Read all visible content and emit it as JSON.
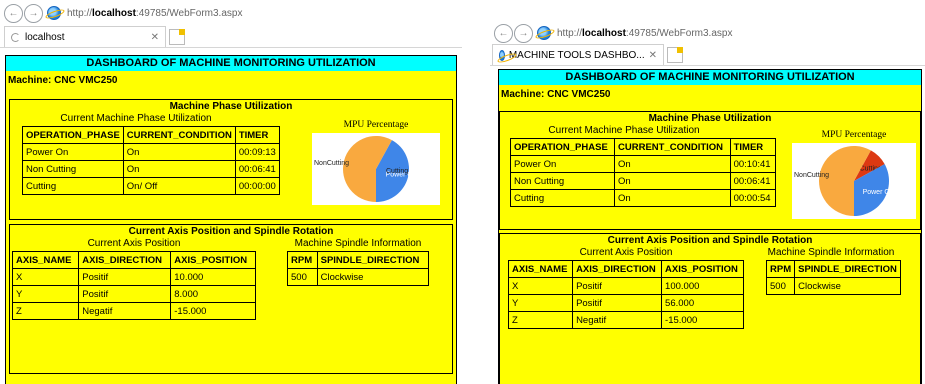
{
  "left": {
    "url_prefix": "http://",
    "url_host": "localhost",
    "url_rest": ":49785/WebForm3.aspx",
    "tab_label": "localhost",
    "dashboard_title": "DASHBOARD OF MACHINE MONITORING UTILIZATION",
    "machine_label": "Machine: CNC VMC250",
    "phase_section_title": "Machine Phase Utilization",
    "phase_table_caption": "Current Machine Phase Utilization",
    "phase_headers": [
      "OPERATION_PHASE",
      "CURRENT_CONDITION",
      "TIMER"
    ],
    "phase_rows": [
      [
        "Power On",
        "On",
        "00:09:13"
      ],
      [
        "Non Cutting",
        "On",
        "00:06:41"
      ],
      [
        "Cutting",
        "On/ Off",
        "00:00:00"
      ]
    ],
    "chart_title": "MPU Percentage",
    "axis_section_title": "Current Axis Position and Spindle Rotation",
    "axis_table_caption": "Current Axis Position",
    "axis_headers": [
      "AXIS_NAME",
      "AXIS_DIRECTION",
      "AXIS_POSITION"
    ],
    "axis_rows": [
      [
        "X",
        "Positif",
        "10.000"
      ],
      [
        "Y",
        "Positif",
        "8.000"
      ],
      [
        "Z",
        "Negatif",
        "-15.000"
      ]
    ],
    "spindle_caption": "Machine Spindle Information",
    "spindle_headers": [
      "RPM",
      "SPINDLE_DIRECTION"
    ],
    "spindle_rows": [
      [
        "500",
        "Clockwise"
      ]
    ],
    "chart_data": {
      "type": "pie",
      "title": "MPU Percentage",
      "categories": [
        "NonCutting",
        "Cutting",
        "Power On"
      ],
      "values": [
        0.58,
        0.0,
        0.42
      ],
      "colors": [
        "#f9a93f",
        "#dc3912",
        "#3f86e8"
      ]
    }
  },
  "right": {
    "url_prefix": "http://",
    "url_host": "localhost",
    "url_rest": ":49785/WebForm3.aspx",
    "tab_label": "MACHINE TOOLS DASHBO...",
    "dashboard_title": "DASHBOARD OF MACHINE MONITORING UTILIZATION",
    "machine_label": "Machine: CNC VMC250",
    "phase_section_title": "Machine Phase Utilization",
    "phase_table_caption": "Current Machine Phase Utilization",
    "phase_headers": [
      "OPERATION_PHASE",
      "CURRENT_CONDITION",
      "TIMER"
    ],
    "phase_rows": [
      [
        "Power On",
        "On",
        "00:10:41"
      ],
      [
        "Non Cutting",
        "On",
        "00:06:41"
      ],
      [
        "Cutting",
        "On",
        "00:00:54"
      ]
    ],
    "chart_title": "MPU Percentage",
    "axis_section_title": "Current Axis Position and Spindle Rotation",
    "axis_table_caption": "Current Axis Position",
    "axis_headers": [
      "AXIS_NAME",
      "AXIS_DIRECTION",
      "AXIS_POSITION"
    ],
    "axis_rows": [
      [
        "X",
        "Positif",
        "100.000"
      ],
      [
        "Y",
        "Positif",
        "56.000"
      ],
      [
        "Z",
        "Negatif",
        "-15.000"
      ]
    ],
    "spindle_caption": "Machine Spindle Information",
    "spindle_headers": [
      "RPM",
      "SPINDLE_DIRECTION"
    ],
    "spindle_rows": [
      [
        "500",
        "Clockwise"
      ]
    ],
    "chart_data": {
      "type": "pie",
      "title": "MPU Percentage",
      "categories": [
        "NonCutting",
        "Cutting",
        "Power On"
      ],
      "values": [
        0.58,
        0.09,
        0.33
      ],
      "colors": [
        "#f9a93f",
        "#dc3912",
        "#3f86e8"
      ]
    }
  }
}
